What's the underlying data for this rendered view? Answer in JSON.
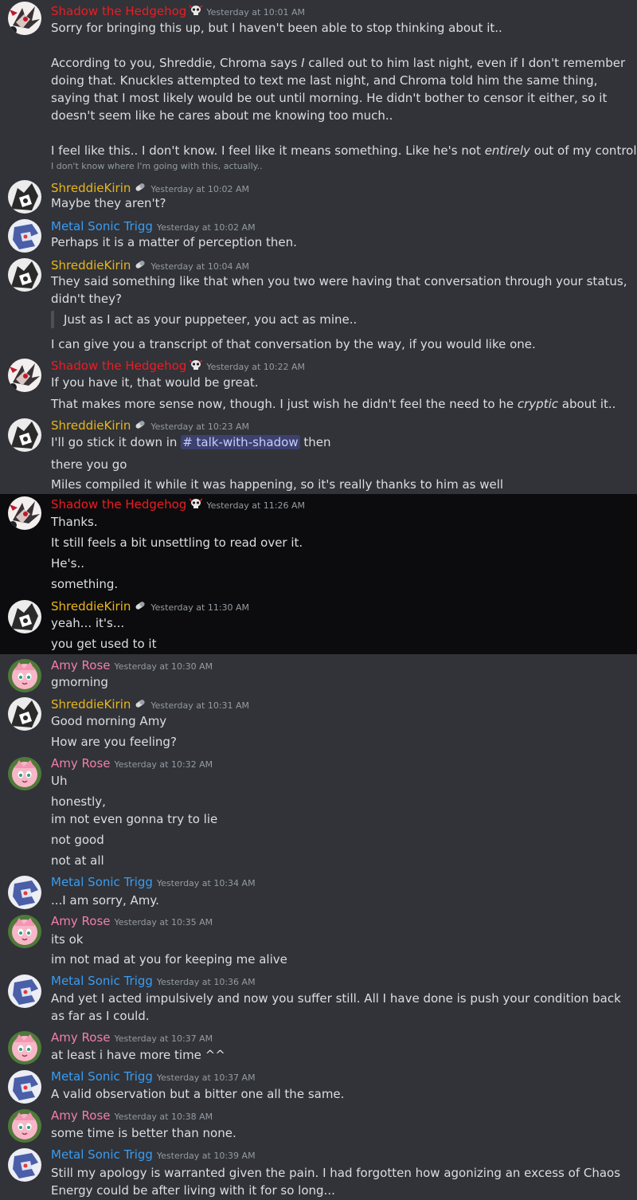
{
  "colors": {
    "shadow": "#ed1c24",
    "shreddie": "#e8b61c",
    "metal": "#3a9cf2",
    "amy": "#f47fa8",
    "background": "#313338",
    "highlight_band": "#0c0c0e"
  },
  "messages": [
    {
      "author": "Shadow the Hedgehog",
      "timestamp": "Yesterday at 10:01 AM",
      "l1": "Sorry for bringing this up, but I haven't been able to stop thinking about it..",
      "l2a": "According to you, Shreddie, Chroma says ",
      "l2b": "I",
      "l2c": " called out to him last night, even if I don't remember doing that. Knuckles attempted to text me last night, and Chroma told him the same thing, saying that I most likely would be out until morning. He didn't bother to censor it either, so it doesn't seem like he cares about me knowing too much..",
      "l3a": "I feel like this.. I don't know. I feel like it means something. Like he's not ",
      "l3b": "entirely",
      "l3c": " out of my control.",
      "small": "I don't know where I'm going with this, actually.."
    },
    {
      "author": "ShreddieKirin",
      "timestamp": "Yesterday at 10:02 AM",
      "l1": "Maybe they aren't?"
    },
    {
      "author": "Metal Sonic Trigg",
      "timestamp": "Yesterday at 10:02 AM",
      "l1": "Perhaps it is a matter of perception then."
    },
    {
      "author": "ShreddieKirin",
      "timestamp": "Yesterday at 10:04 AM",
      "l1": "They said something like that when you two were having that conversation through your status, didn't they?",
      "quote": "Just as I act as your puppeteer, you act as mine..",
      "l2": "I can give you a transcript of that conversation by the way, if you would like one."
    },
    {
      "author": "Shadow the Hedgehog",
      "timestamp": "Yesterday at 10:22 AM",
      "l1": "If you have it, that would be great.",
      "l2a": "That makes more sense now, though. I just wish he didn't feel the need to he ",
      "l2b": "cryptic",
      "l2c": " about it.."
    },
    {
      "author": "ShreddieKirin",
      "timestamp": "Yesterday at 10:23 AM",
      "l1a": "I'll go stick it down in ",
      "channel": "# talk-with-shadow",
      "l1b": " then",
      "l2": "there you go",
      "l3": "Miles compiled it while it was happening, so it's really thanks to him as well"
    },
    {
      "author": "Shadow the Hedgehog",
      "timestamp": "Yesterday at 11:26 AM",
      "l1": "Thanks.",
      "l2": "It still feels a bit unsettling to read over it.",
      "l3": "He's..",
      "l4": "something."
    },
    {
      "author": "ShreddieKirin",
      "timestamp": "Yesterday at 11:30 AM",
      "l1": "yeah... it's...",
      "l2": "you get used to it"
    },
    {
      "author": "Amy Rose",
      "timestamp": "Yesterday at 10:30 AM",
      "l1": "gmorning"
    },
    {
      "author": "ShreddieKirin",
      "timestamp": "Yesterday at 10:31 AM",
      "l1": "Good morning Amy",
      "l2": "How are you feeling?"
    },
    {
      "author": "Amy Rose",
      "timestamp": "Yesterday at 10:32 AM",
      "l1": "Uh",
      "l2": "honestly,",
      "l3": "im not even gonna try to lie",
      "l4": "not good",
      "l5": "not at all"
    },
    {
      "author": "Metal Sonic Trigg",
      "timestamp": "Yesterday at 10:34 AM",
      "l1": "...I am sorry, Amy."
    },
    {
      "author": "Amy Rose",
      "timestamp": "Yesterday at 10:35 AM",
      "l1": "its ok",
      "l2": "im not mad at you for keeping me alive"
    },
    {
      "author": "Metal Sonic Trigg",
      "timestamp": "Yesterday at 10:36 AM",
      "l1": "And yet I acted impulsively and now you suffer still. All I have done is push your condition back as far as I could."
    },
    {
      "author": "Amy Rose",
      "timestamp": "Yesterday at 10:37 AM",
      "l1": "at least i have more time ^^"
    },
    {
      "author": "Metal Sonic Trigg",
      "timestamp": "Yesterday at 10:37 AM",
      "l1": "A valid observation but a bitter one all the same."
    },
    {
      "author": "Amy Rose",
      "timestamp": "Yesterday at 10:38 AM",
      "l1": "some time is better than none."
    },
    {
      "author": "Metal Sonic Trigg",
      "timestamp": "Yesterday at 10:39 AM",
      "l1": "Still my apology is warranted given the pain. I had forgotten how agonizing an excess of Chaos Energy could be after living with it for so long..."
    }
  ]
}
